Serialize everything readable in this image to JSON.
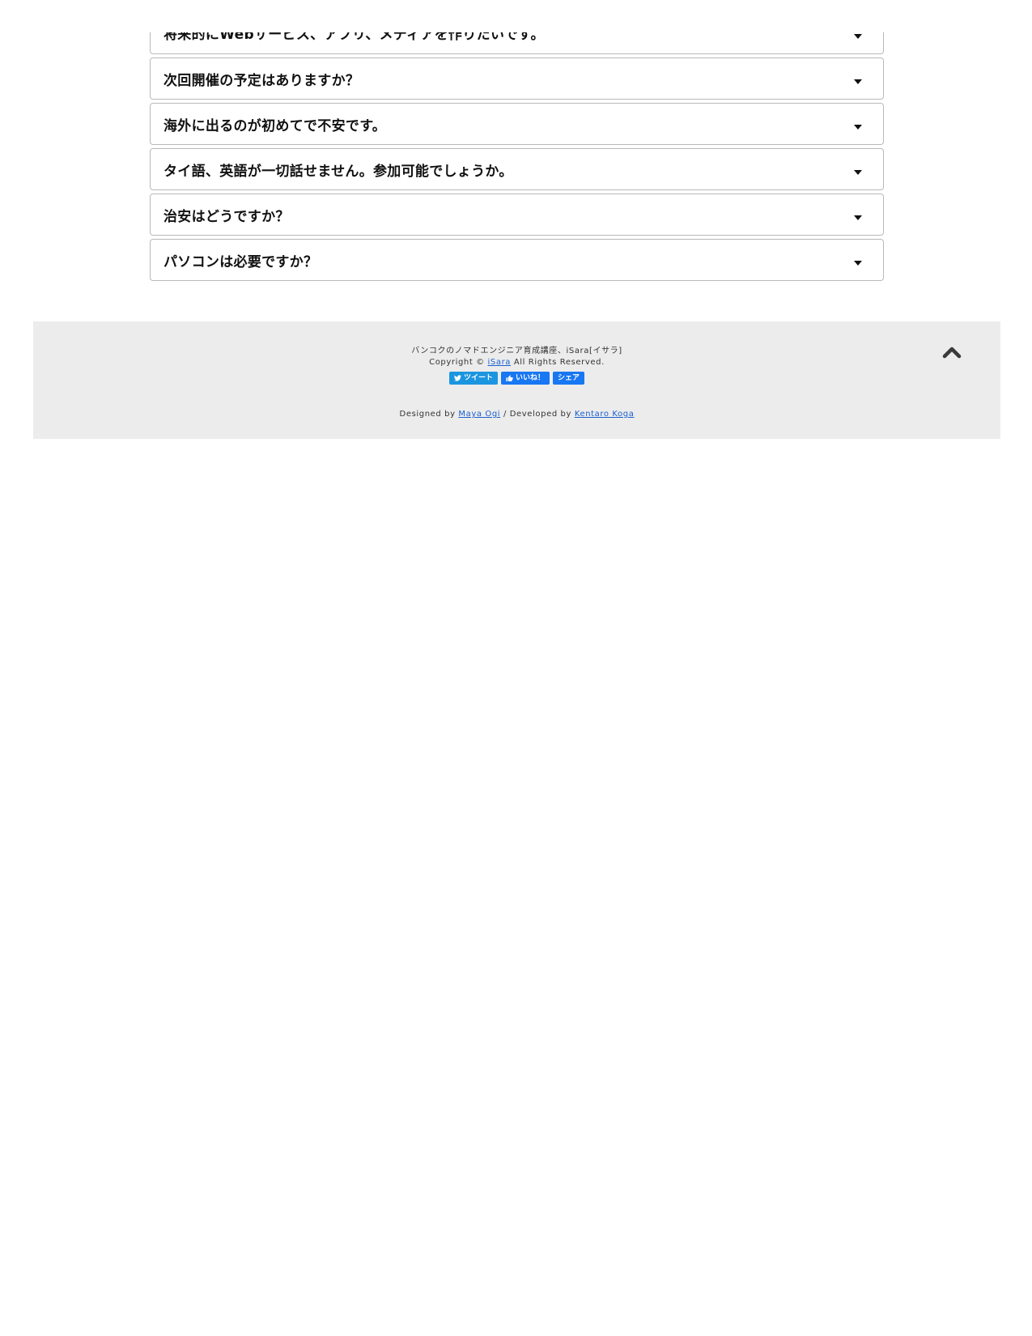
{
  "faq": {
    "items": [
      {
        "question": "将来的にWebサービス、アプリ、メディアを作りたいです。"
      },
      {
        "question": "次回開催の予定はありますか？"
      },
      {
        "question": "海外に出るのが初めてで不安です。"
      },
      {
        "question": "タイ語、英語が一切話せません。参加可能でしょうか。"
      },
      {
        "question": "治安はどうですか？"
      },
      {
        "question": "パソコンは必要ですか？"
      }
    ]
  },
  "footer": {
    "tagline": "バンコクのノマドエンジニア育成講座、iSara[イサラ]",
    "copyright_prefix": "Copyright © ",
    "copyright_link": "iSara",
    "copyright_suffix": " All Rights Reserved.",
    "social": {
      "tweet_label": "ツイート",
      "like_label": "いいね！",
      "share_label": "シェア"
    },
    "designed_by_prefix": "Designed by ",
    "designer": "Maya Ogi",
    "developed_by_prefix": " / Developed by ",
    "developer": "Kentaro Koga"
  },
  "icons": {
    "caret": "caret-down-icon",
    "to_top": "chevron-up-icon",
    "twitter": "twitter-bird-icon",
    "facebook_like": "thumbs-up-icon"
  },
  "colors": {
    "footer_bg": "#ececec",
    "link": "#1a5fcf",
    "twitter": "#1b95e0",
    "facebook": "#1877f2"
  }
}
